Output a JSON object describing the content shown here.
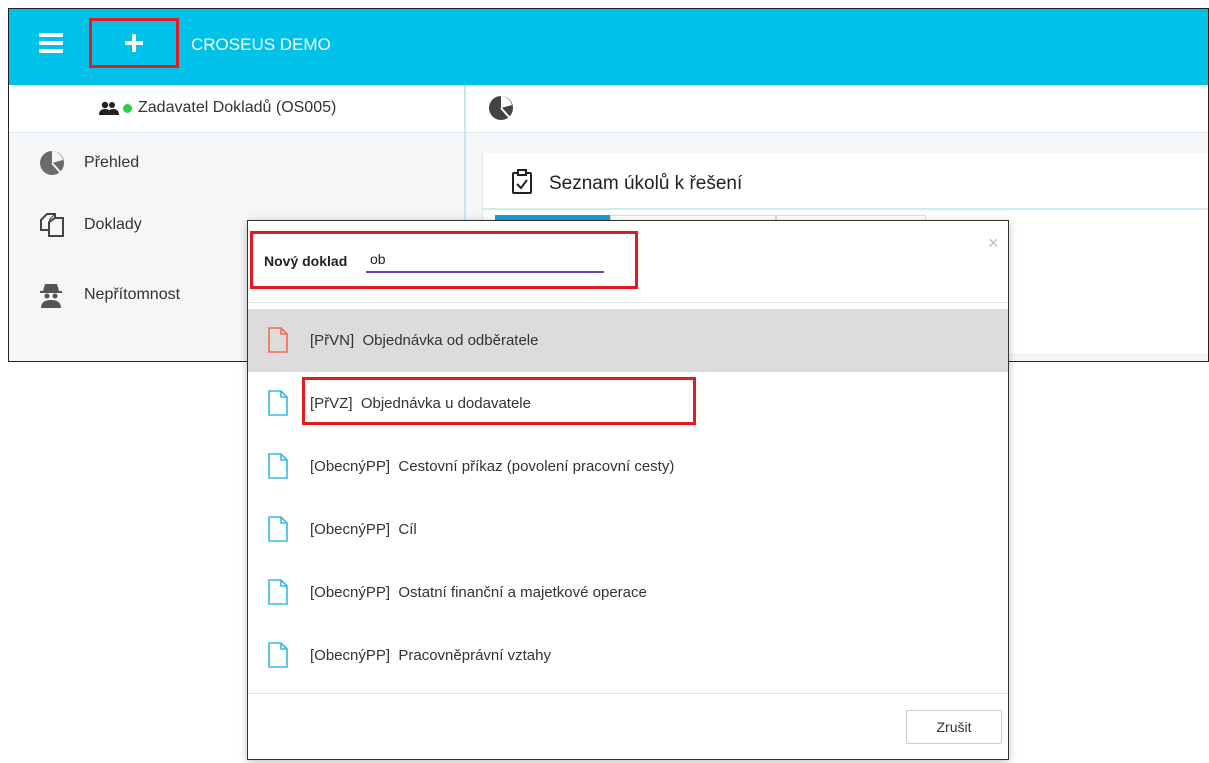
{
  "app": {
    "title": "CROSEUS DEMO"
  },
  "user": {
    "name": "Zadavatel Dokladů (OS005)"
  },
  "sidebar": {
    "items": [
      {
        "label": "Přehled",
        "icon": "pie-chart-icon"
      },
      {
        "label": "Doklady",
        "icon": "documents-icon"
      },
      {
        "label": "Nepřítomnost",
        "icon": "spy-icon"
      }
    ]
  },
  "panel": {
    "title": "Seznam úkolů k řešení"
  },
  "dialog": {
    "new_label": "Nový doklad",
    "search_value": "ob",
    "close": "×",
    "items": [
      {
        "code": "[PřVN]  ",
        "name": "Objednávka od odběratele",
        "selected": true
      },
      {
        "code": "[PřVZ]  ",
        "name": "Objednávka u dodavatele",
        "selected": false
      },
      {
        "code": "[ObecnýPP]  ",
        "name": "Cestovní příkaz (povolení pracovní cesty)",
        "selected": false
      },
      {
        "code": "[ObecnýPP]  ",
        "name": "Cíl",
        "selected": false
      },
      {
        "code": "[ObecnýPP]  ",
        "name": "Ostatní finanční a majetkové operace",
        "selected": false
      },
      {
        "code": "[ObecnýPP]  ",
        "name": "Pracovněprávní vztahy",
        "selected": false
      }
    ],
    "cancel_label": "Zrušit"
  },
  "colors": {
    "accent": "#00c2e8",
    "highlight": "#e21b23",
    "doc_selected": "#f36c4f",
    "doc": "#37b8e5"
  }
}
